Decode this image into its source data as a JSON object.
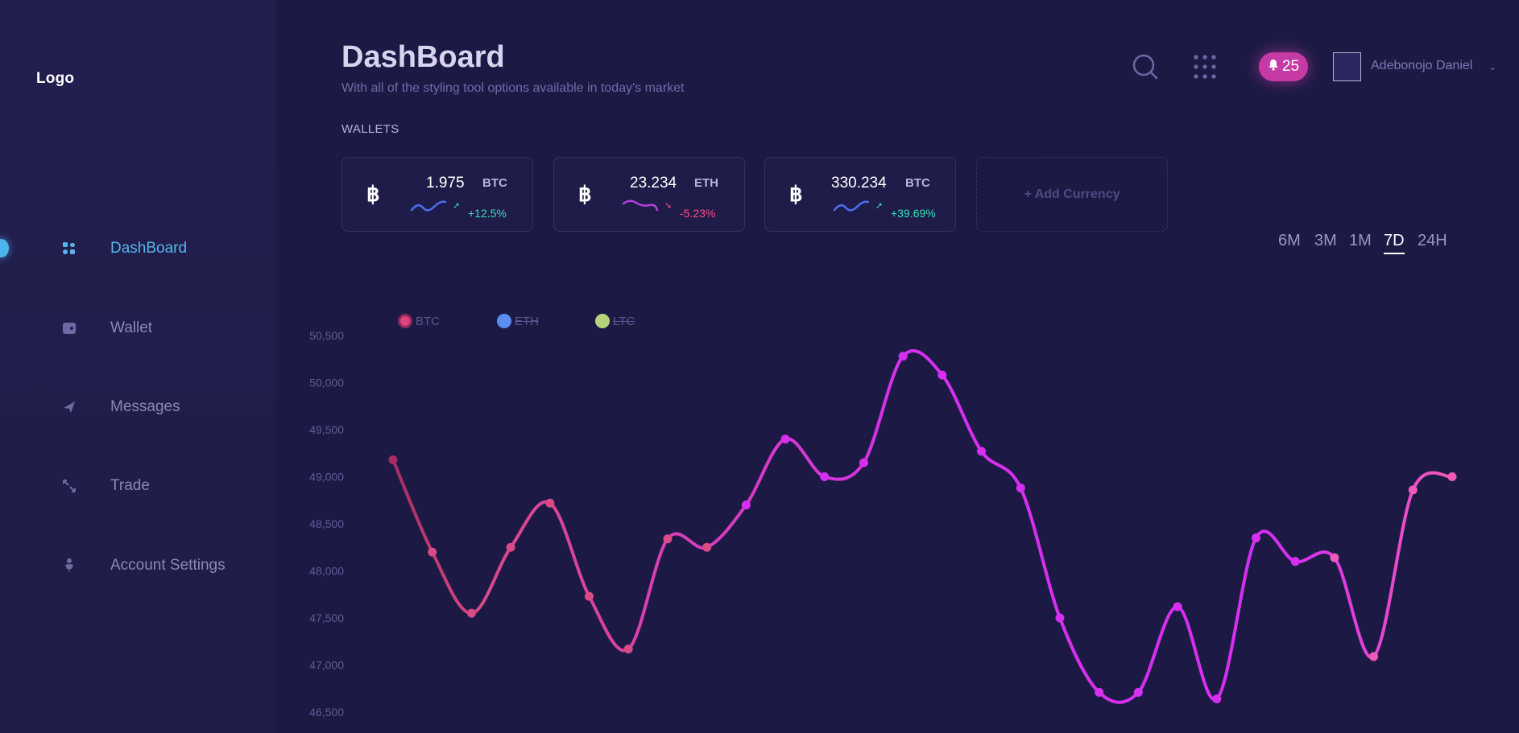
{
  "sidebar": {
    "logo": "Logo",
    "items": [
      {
        "label": "DashBoard",
        "icon": "dashboard-icon",
        "active": true
      },
      {
        "label": "Wallet",
        "icon": "wallet-icon",
        "active": false
      },
      {
        "label": "Messages",
        "icon": "send-icon",
        "active": false
      },
      {
        "label": "Trade",
        "icon": "exchange-icon",
        "active": false
      },
      {
        "label": "Account Settings",
        "icon": "person-icon",
        "active": false
      }
    ]
  },
  "header": {
    "title": "DashBoard",
    "subtitle": "With all of the styling tool options available in today's market",
    "search_icon": "search-icon",
    "apps_icon": "grid-icon",
    "notification_icon": "bell-icon",
    "notification_count": "25",
    "user_name": "Adebonojo Daniel",
    "user_caret": "⌄"
  },
  "wallets": {
    "section_label": "WALLETS",
    "cards": [
      {
        "icon": "bitcoin-icon",
        "symbol": "฿",
        "amount": "1.975",
        "ticker": "BTC",
        "change": "+12.5%",
        "direction": "up"
      },
      {
        "icon": "bitcoin-icon",
        "symbol": "฿",
        "amount": "23.234",
        "ticker": "ETH",
        "change": "-5.23%",
        "direction": "down"
      },
      {
        "icon": "bitcoin-icon",
        "symbol": "฿",
        "amount": "330.234",
        "ticker": "BTC",
        "change": "+39.69%",
        "direction": "up"
      }
    ],
    "add_label": "+ Add Currency"
  },
  "ranges": {
    "options": [
      "6M",
      "3M",
      "1M",
      "7D",
      "24H"
    ],
    "selected": "7D"
  },
  "colors": {
    "accent": "#55b6ea",
    "up": "#38e2b6",
    "down": "#ff4f7a",
    "line_start": "#d94a86",
    "line_mid": "#d62ff0",
    "line_end": "#f05ab8"
  },
  "chart_data": {
    "type": "line",
    "legend": [
      {
        "name": "BTC",
        "color": "#e0437c",
        "visible": true
      },
      {
        "name": "ETH",
        "color": "#5b8ef0",
        "visible": false
      },
      {
        "name": "LTC",
        "color": "#b7d37a",
        "visible": false
      }
    ],
    "legend_placement": "top-left",
    "y_ticks": [
      "50,500",
      "50,000",
      "49,500",
      "49,000",
      "48,500",
      "48,000",
      "47,500",
      "47,000",
      "46,500"
    ],
    "ylim": [
      46500,
      50500
    ],
    "grid": false,
    "series": [
      {
        "name": "BTC",
        "values": [
          49180,
          48200,
          47550,
          48250,
          48720,
          47730,
          47170,
          48340,
          48250,
          48700,
          49400,
          49000,
          49150,
          50280,
          50080,
          49270,
          48880,
          47500,
          46710,
          46710,
          47620,
          46640,
          48350,
          48100,
          48140,
          47090,
          48860,
          49000
        ]
      }
    ]
  }
}
